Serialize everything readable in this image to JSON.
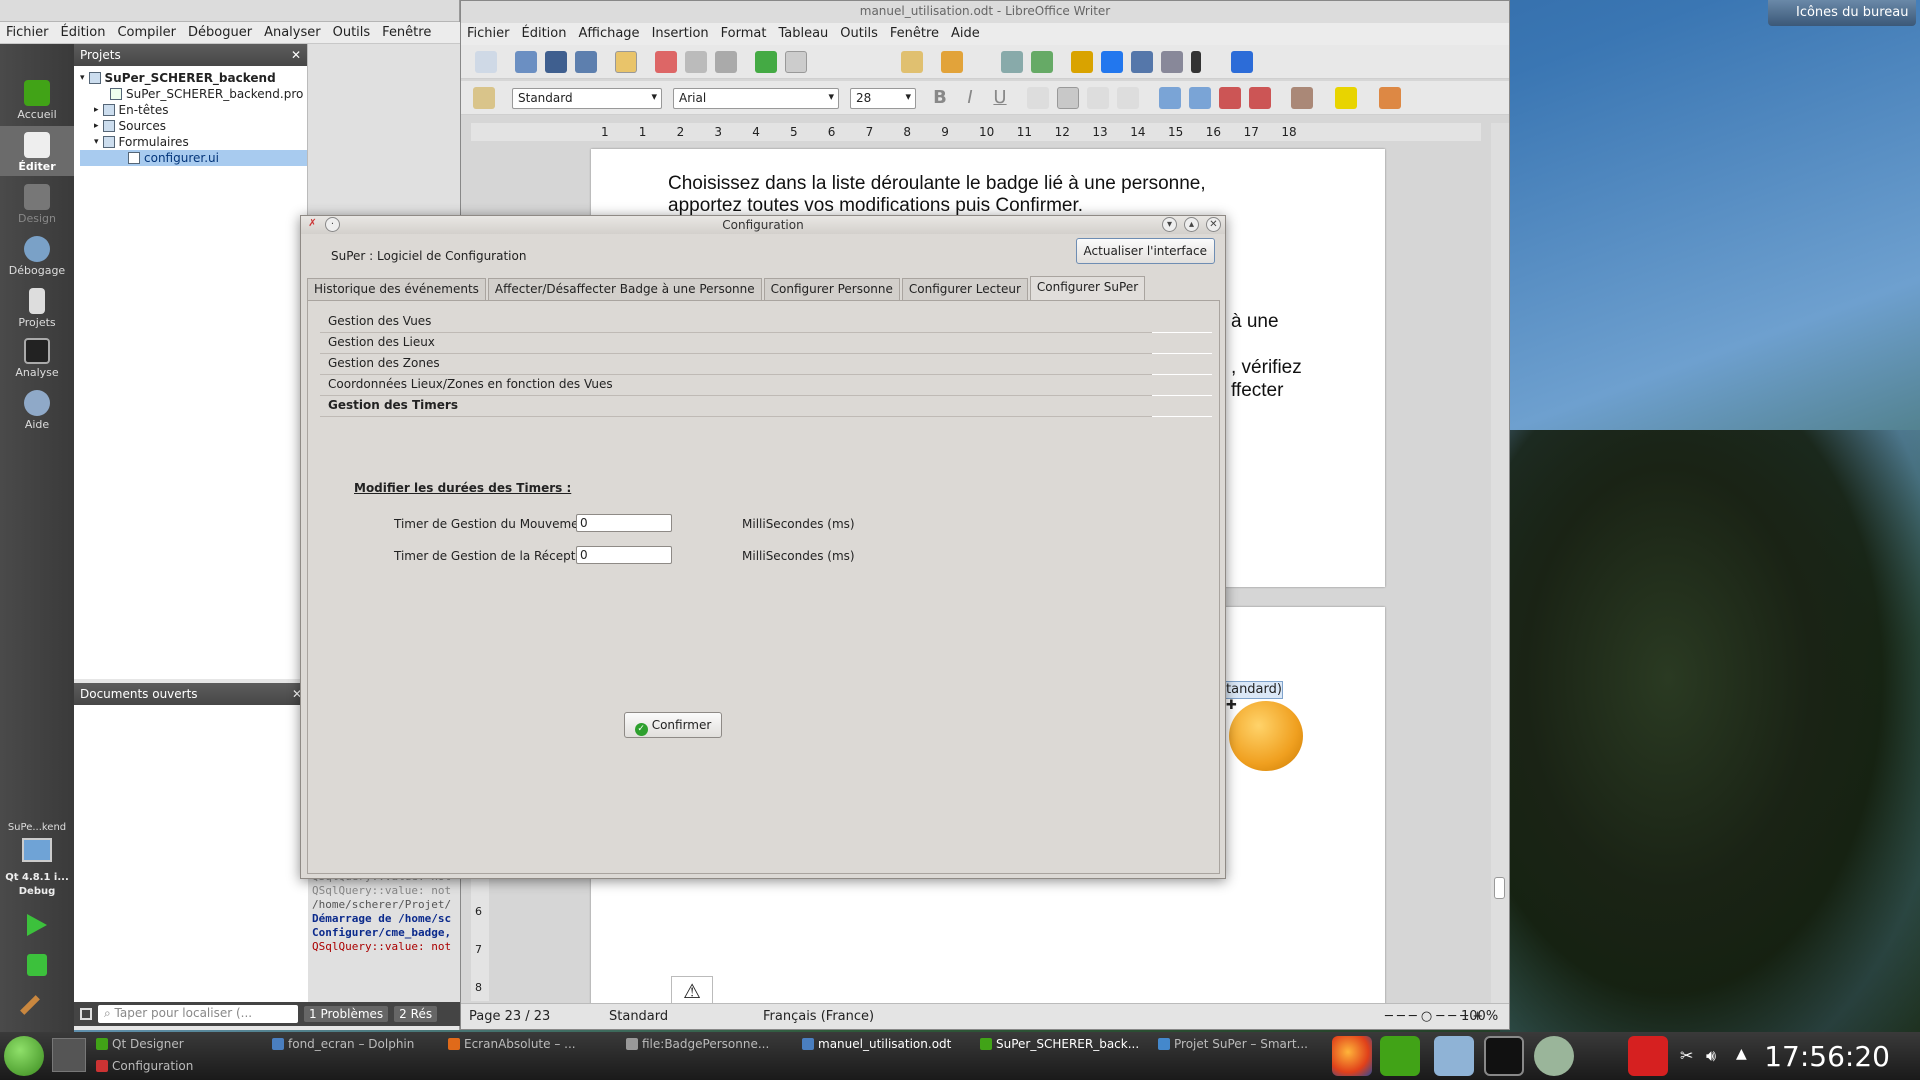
{
  "desktop": {
    "icons_button": "Icônes du bureau"
  },
  "qtcreator": {
    "menu": [
      "Fichier",
      "Édition",
      "Compiler",
      "Déboguer",
      "Analyser",
      "Outils",
      "Fenêtre"
    ],
    "modes": [
      "Accueil",
      "Éditer",
      "Design",
      "Débogage",
      "Projets",
      "Analyse",
      "Aide"
    ],
    "projects_pane_title": "Projets",
    "tree": {
      "root": "SuPer_SCHERER_backend",
      "pro_file": "SuPer_SCHERER_backend.pro",
      "headers": "En-têtes",
      "sources": "Sources",
      "forms": "Formulaires",
      "form_file": "configurer.ui"
    },
    "open_docs_title": "Documents ouverts",
    "target": {
      "project": "SuPe...kend",
      "kit": "Qt 4.8.1 i...",
      "mode": "Debug"
    },
    "output_lines": [
      "QSqlQuery::value: not",
      "QSqlQuery::value: not",
      "/home/scherer/Projet/",
      "Démarrage de /home/sc",
      "Configurer/cme_badge,",
      "QSqlQuery::value: not"
    ],
    "locate_placeholder": "Taper pour localiser (...",
    "status_tabs": [
      {
        "num": "1",
        "label": "Problèmes"
      },
      {
        "num": "2",
        "label": "Rés"
      }
    ]
  },
  "writer": {
    "title": "manuel_utilisation.odt - LibreOffice Writer",
    "menu": [
      "Fichier",
      "Édition",
      "Affichage",
      "Insertion",
      "Format",
      "Tableau",
      "Outils",
      "Fenêtre",
      "Aide"
    ],
    "style_value": "Standard",
    "font_value": "Arial",
    "size_value": "28",
    "ruler_numbers": [
      "1",
      "1",
      "2",
      "3",
      "4",
      "5",
      "6",
      "7",
      "8",
      "9",
      "10",
      "11",
      "12",
      "13",
      "14",
      "15",
      "16",
      "17",
      "18"
    ],
    "doc_lines": [
      "Choisissez dans la liste déroulante le badge lié à une personne,",
      "apportez toutes vos modifications puis Confirmer."
    ],
    "doc_fragments": [
      "à une",
      ", vérifiez",
      "ffecter"
    ],
    "frame_label": "tandard)",
    "status": {
      "page": "Page 23 / 23",
      "style": "Standard",
      "language": "Français (France)",
      "zoom": "100%"
    },
    "vruler_numbers": [
      "6",
      "7",
      "8"
    ]
  },
  "dialog": {
    "title": "Configuration",
    "app_title": "SuPer : Logiciel de Configuration",
    "refresh_button": "Actualiser l'interface",
    "tabs": [
      "Historique des événements",
      "Affecter/Désaffecter Badge à une Personne",
      "Configurer Personne",
      "Configurer Lecteur",
      "Configurer SuPer"
    ],
    "active_tab": "Configurer SuPer",
    "sections": [
      "Gestion des Vues",
      "Gestion des Lieux",
      "Gestion des Zones",
      "Coordonnées Lieux/Zones en fonction des Vues",
      "Gestion des Timers"
    ],
    "timers_heading": "Modifier les durées des Timers :",
    "fields": [
      {
        "label": "Timer de Gestion du Mouvement :",
        "value": "0",
        "unit": "MilliSecondes (ms)"
      },
      {
        "label": "Timer de Gestion de la Réception :",
        "value": "0",
        "unit": "MilliSecondes (ms)"
      }
    ],
    "confirm_button": "Confirmer"
  },
  "taskbar": {
    "tasks_top": [
      "Qt Designer",
      "fond_ecran – Dolphin",
      "EcranAbsolute – ...",
      "file:BadgePersonne...",
      "manuel_utilisation.odt",
      "SuPer_SCHERER_back...",
      "Projet SuPer – Smart..."
    ],
    "tasks_bottom": [
      "Configuration"
    ],
    "clock": "17:56:20"
  }
}
